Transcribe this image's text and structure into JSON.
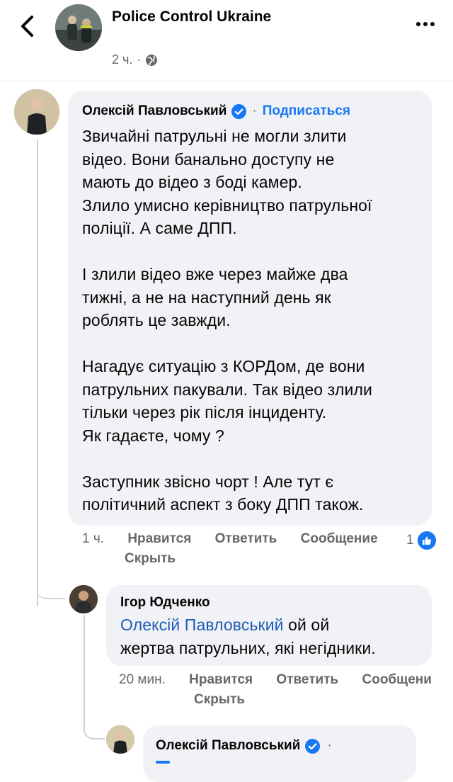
{
  "header": {
    "page_name": "Police Control Ukraine",
    "time_ago": "2 ч.",
    "separator": "·"
  },
  "comments": [
    {
      "author": "Олексій Павловський",
      "follow_label": "Подписаться",
      "follow_separator": "·",
      "text": "Звичайні патрульні не могли злити\nвідео. Вони банально доступу не\nмають до відео з боді камер.\nЗлило умисно керівництво патрульної\nполіції. А саме ДПП.\n\nІ злили відео вже через майже два\nтижні, а не на наступний день як\nроблять це завжди.\n\nНагадує ситуацію з КОРДом, де вони\nпатрульних пакували. Так відео злили\nтільки через рік після інциденту.\nЯк гадаєте, чому ?\n\nЗаступник звісно чорт ! Але тут є\nполітичний аспект з боку ДПП також.",
      "time": "1 ч.",
      "like_label": "Нравится",
      "reply_label": "Ответить",
      "message_label": "Сообщение",
      "hide_label": "Скрыть",
      "reaction_count": "1"
    },
    {
      "author": "Ігор Юдченко",
      "mention": "Олексій Павловський",
      "text_line1": " ой ой",
      "text_line2": "жертва патрульних, які негідники.",
      "time": "20 мин.",
      "like_label": "Нравится",
      "reply_label": "Ответить",
      "message_label": "Сообщени",
      "hide_label": "Скрыть"
    },
    {
      "author": "Олексій Павловський",
      "follow_separator": "·"
    }
  ],
  "colors": {
    "link_blue": "#1877f2",
    "mention_blue": "#1f5bb7",
    "bubble_bg": "#f0f2f5",
    "meta_gray": "#65676b"
  },
  "icons": {
    "back": "chevron-left-icon",
    "more": "more-horizontal-icon",
    "globe": "globe-icon",
    "verified": "verified-badge-icon",
    "like": "thumbs-up-icon"
  }
}
